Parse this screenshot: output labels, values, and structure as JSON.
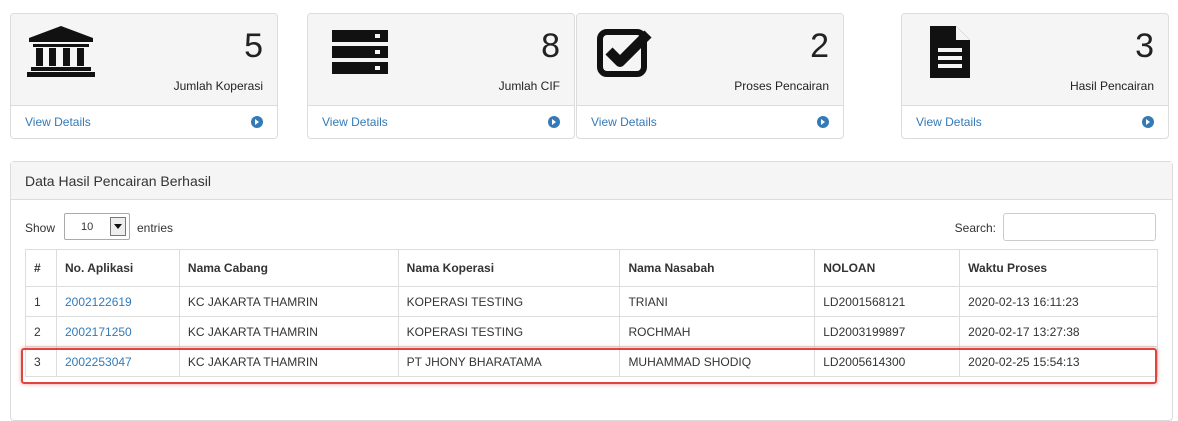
{
  "stats": [
    {
      "icon": "bank-icon",
      "value": "5",
      "label": "Jumlah Koperasi",
      "link": "View Details"
    },
    {
      "icon": "server-icon",
      "value": "8",
      "label": "Jumlah CIF",
      "link": "View Details"
    },
    {
      "icon": "check-square-icon",
      "value": "2",
      "label": "Proses Pencairan",
      "link": "View Details"
    },
    {
      "icon": "document-icon",
      "value": "3",
      "label": "Hasil Pencairan",
      "link": "View Details"
    }
  ],
  "panel": {
    "title": "Data Hasil Pencairan Berhasil",
    "show_label": "Show",
    "entries_value": "10",
    "entries_label": "entries",
    "search_label": "Search:",
    "search_value": ""
  },
  "table": {
    "headers": [
      "#",
      "No. Aplikasi",
      "Nama Cabang",
      "Nama Koperasi",
      "Nama Nasabah",
      "NOLOAN",
      "Waktu Proses"
    ],
    "rows": [
      [
        "1",
        "2002122619",
        "KC JAKARTA THAMRIN",
        "KOPERASI TESTING",
        "TRIANI",
        "LD2001568121",
        "2020-02-13 16:11:23"
      ],
      [
        "2",
        "2002171250",
        "KC JAKARTA THAMRIN",
        "KOPERASI TESTING",
        "ROCHMAH",
        "LD2003199897",
        "2020-02-17 13:27:38"
      ],
      [
        "3",
        "2002253047",
        "KC JAKARTA THAMRIN",
        "PT JHONY BHARATAMA",
        "MUHAMMAD SHODIQ",
        "LD2005614300",
        "2020-02-25 15:54:13"
      ]
    ]
  },
  "colors": {
    "link": "#337ab7",
    "highlight": "#e0443f"
  }
}
